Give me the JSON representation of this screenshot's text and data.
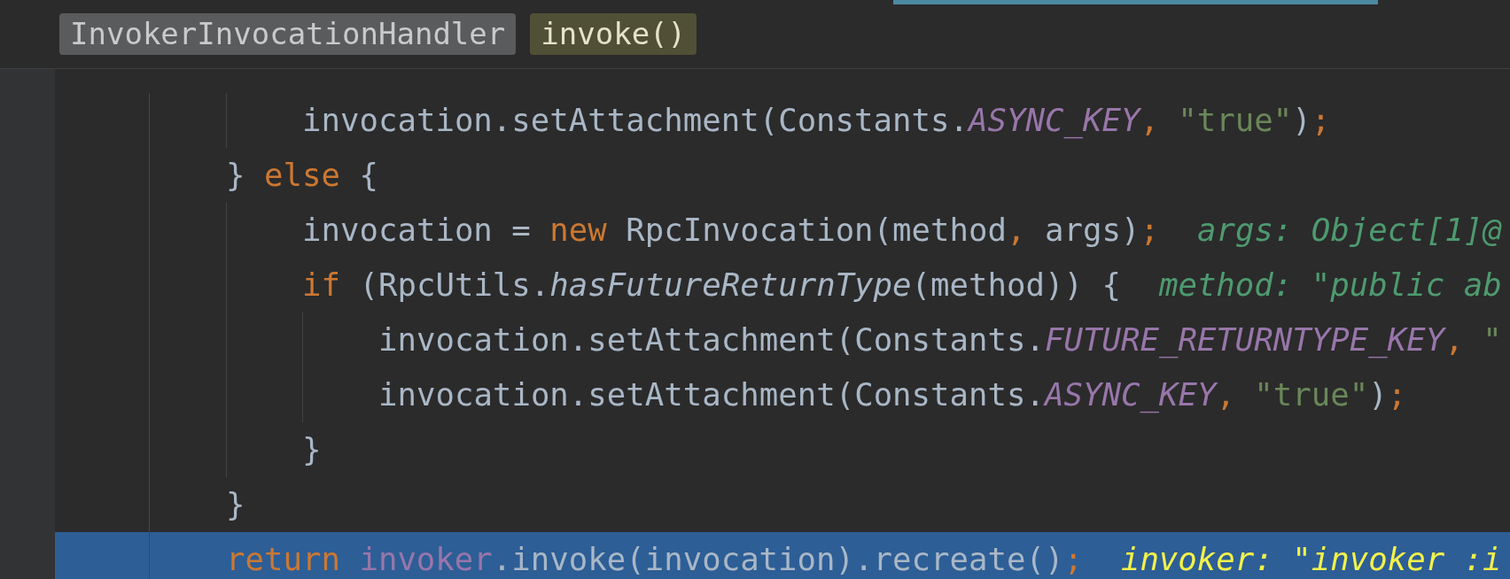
{
  "breadcrumbs": [
    {
      "label": "InvokerInvocationHandler",
      "kind": "class"
    },
    {
      "label": "invoke()",
      "kind": "method"
    }
  ],
  "lines": [
    {
      "current": false,
      "tokens": [
        {
          "kind": "code",
          "text": "        invocation.setAttachment(Constants."
        },
        {
          "kind": "constant",
          "text": "ASYNC_KEY"
        },
        {
          "kind": "punct",
          "text": ", "
        },
        {
          "kind": "string",
          "text": "\"true\""
        },
        {
          "kind": "code",
          "text": ")"
        },
        {
          "kind": "punct",
          "text": ";"
        }
      ]
    },
    {
      "current": false,
      "tokens": [
        {
          "kind": "code",
          "text": "    } "
        },
        {
          "kind": "keyword",
          "text": "else"
        },
        {
          "kind": "code",
          "text": " {"
        }
      ]
    },
    {
      "current": false,
      "tokens": [
        {
          "kind": "code",
          "text": "        invocation = "
        },
        {
          "kind": "keyword",
          "text": "new"
        },
        {
          "kind": "code",
          "text": " RpcInvocation(method"
        },
        {
          "kind": "punct",
          "text": ", "
        },
        {
          "kind": "code",
          "text": "args)"
        },
        {
          "kind": "punct",
          "text": ";"
        }
      ],
      "hint": "args: Object[1]@"
    },
    {
      "current": false,
      "tokens": [
        {
          "kind": "keyword",
          "text": "        if"
        },
        {
          "kind": "code",
          "text": " (RpcUtils."
        },
        {
          "kind": "call",
          "text": "hasFutureReturnType"
        },
        {
          "kind": "code",
          "text": "(method)) {"
        }
      ],
      "hint": "method: \"public ab"
    },
    {
      "current": false,
      "tokens": [
        {
          "kind": "code",
          "text": "            invocation.setAttachment(Constants."
        },
        {
          "kind": "constant",
          "text": "FUTURE_RETURNTYPE_KEY"
        },
        {
          "kind": "punct",
          "text": ", "
        },
        {
          "kind": "string",
          "text": "\""
        }
      ]
    },
    {
      "current": false,
      "tokens": [
        {
          "kind": "code",
          "text": "            invocation.setAttachment(Constants."
        },
        {
          "kind": "constant",
          "text": "ASYNC_KEY"
        },
        {
          "kind": "punct",
          "text": ", "
        },
        {
          "kind": "string",
          "text": "\"true\""
        },
        {
          "kind": "code",
          "text": ")"
        },
        {
          "kind": "punct",
          "text": ";"
        }
      ]
    },
    {
      "current": false,
      "tokens": [
        {
          "kind": "code",
          "text": "        }"
        }
      ]
    },
    {
      "current": false,
      "tokens": [
        {
          "kind": "code",
          "text": "    }"
        }
      ]
    },
    {
      "current": true,
      "tokens": [
        {
          "kind": "keyword",
          "text": "    return "
        },
        {
          "kind": "variable",
          "text": "invoker"
        },
        {
          "kind": "code",
          "text": ".invoke(invocation).recreate()"
        },
        {
          "kind": "punct",
          "text": ";"
        }
      ],
      "hint": "invoker: \"invoker :i"
    }
  ]
}
